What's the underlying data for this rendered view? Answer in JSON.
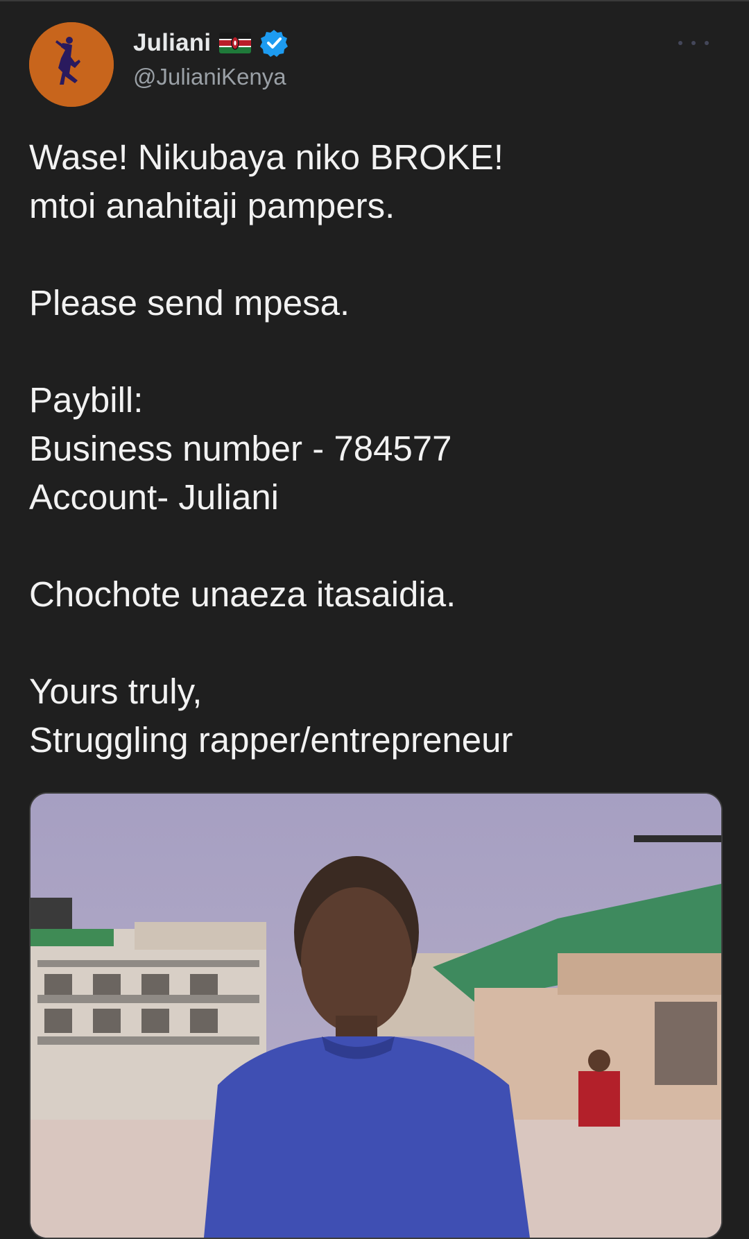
{
  "tweet": {
    "author": {
      "display_name": "Juliani",
      "handle": "@JulianiKenya",
      "flag_icon": "kenya-flag-icon",
      "verified_icon": "verified-badge-icon",
      "verified_color": "#1d9bf0",
      "avatar_bg": "#c8651c"
    },
    "more_icon": "more-options-icon",
    "lines": [
      "Wase! Nikubaya niko BROKE!",
      "mtoi anahitaji pampers.",
      "",
      "Please send mpesa.",
      "",
      "Paybill:",
      "Business number - 784577",
      "Account- Juliani",
      "",
      "Chochote unaeza itasaidia.",
      "",
      "Yours truly,",
      "Struggling rapper/entrepreneur"
    ]
  },
  "colors": {
    "background": "#1f1f1f",
    "text": "#f2f2f2",
    "secondary_text": "#9aa0a6"
  }
}
